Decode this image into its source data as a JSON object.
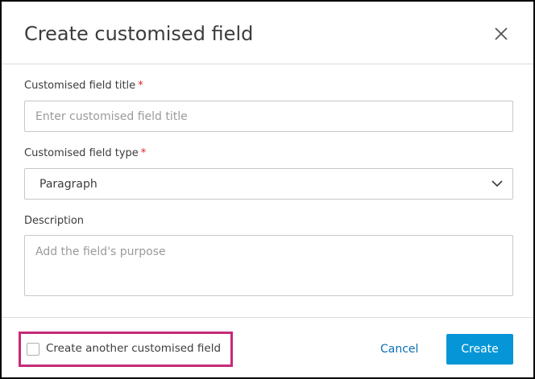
{
  "dialog": {
    "title": "Create customised field"
  },
  "fields": {
    "title_label": "Customised field title",
    "title_placeholder": "Enter customised field title",
    "type_label": "Customised field type",
    "type_value": "Paragraph",
    "description_label": "Description",
    "description_placeholder": "Add the field's purpose",
    "required_marker": "*"
  },
  "footer": {
    "checkbox_label": "Create another customised field",
    "checkbox_checked": false,
    "cancel_label": "Cancel",
    "create_label": "Create"
  },
  "colors": {
    "primary": "#0696d7",
    "link": "#0b6fb5",
    "highlight": "#c62a7a",
    "required": "#e02020"
  }
}
